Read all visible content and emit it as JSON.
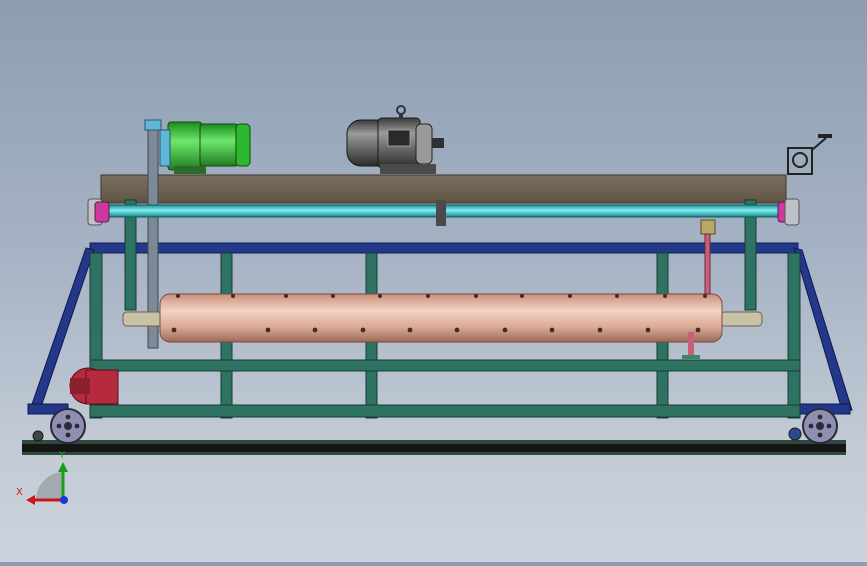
{
  "viewport": {
    "background_top": "#8d9db2",
    "background_bottom": "#cdd3dc"
  },
  "colors": {
    "frame_green": "#2e7262",
    "frame_blue": "#24388a",
    "top_plate": "#6e6152",
    "shaft_cyan": "#3cc6cc",
    "drum_copper": "#d9a893",
    "gear_motor_green": "#3bbf3b",
    "motor_grey": "#6a6a6a",
    "small_motor_red": "#b52a3c",
    "wheel_purple": "#8f8fb2",
    "rail_dark": "#1a1a1a"
  },
  "icons": [
    "triad-axes-icon",
    "eyebolt-icon",
    "crank-handle-icon"
  ],
  "triad": {
    "x_label": "X",
    "y_label": "Y"
  }
}
